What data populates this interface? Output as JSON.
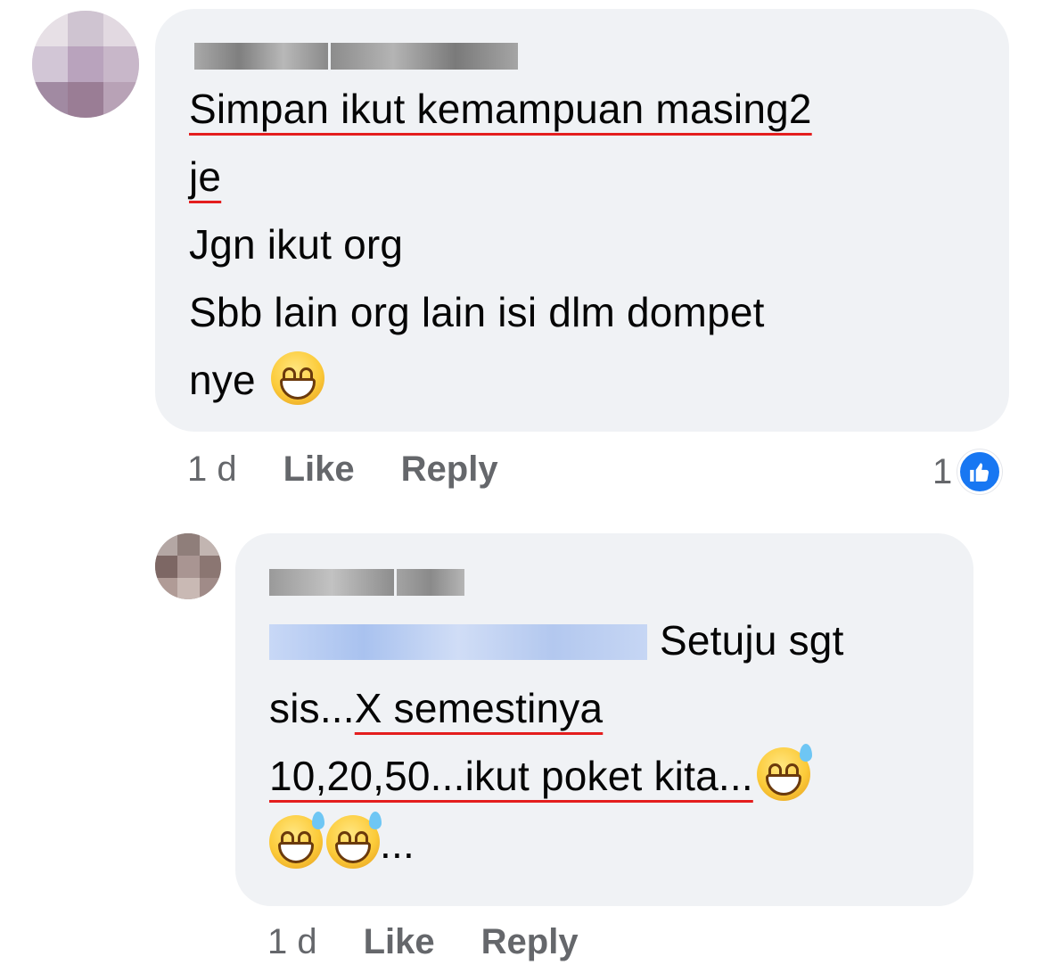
{
  "comments": [
    {
      "lines": [
        "Simpan ikut kemampuan masing2",
        "je",
        "Jgn ikut org",
        "Sbb lain org lain isi dlm dompet",
        "nye"
      ],
      "time": "1 d",
      "like_label": "Like",
      "reply_label": "Reply",
      "reaction_count": "1"
    }
  ],
  "reply": {
    "line1": "Setuju sgt",
    "line2_a": "sis...",
    "line2_b": "X semestinya",
    "line3": "10,20,50...ikut poket kita...",
    "line4": "...",
    "time": "1 d",
    "like_label": "Like",
    "reply_label": "Reply"
  },
  "colors": {
    "bubble": "#f0f2f5",
    "meta": "#65676b",
    "spellcheck": "#e41e1e",
    "like_blue": "#1877f2"
  },
  "icons": {
    "reaction": "thumbs-up-icon",
    "emoji_1": "grinning-face-icon",
    "emoji_2": "grinning-face-with-sweat-icon"
  }
}
